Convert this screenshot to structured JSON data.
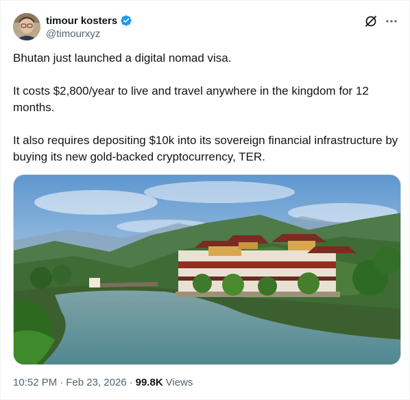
{
  "author": {
    "display_name": "timour kosters",
    "handle": "@timourxyz",
    "verified": true,
    "verified_color": "#1d9bf0"
  },
  "actions": {
    "grok_icon": "grok-icon",
    "more_icon": "more-icon"
  },
  "tweet": {
    "paragraphs": [
      "Bhutan just launched a digital nomad visa.",
      "It costs $2,800/year to live and travel anywhere in the kingdom for 12 months.",
      "It also requires depositing $10k into its sovereign financial infrastructure by buying its new gold-backed cryptocurrency, TER."
    ]
  },
  "meta": {
    "time": "10:52 PM",
    "separator": "·",
    "date": "Feb 23, 2026",
    "views_count": "99.8K",
    "views_label": "Views"
  }
}
